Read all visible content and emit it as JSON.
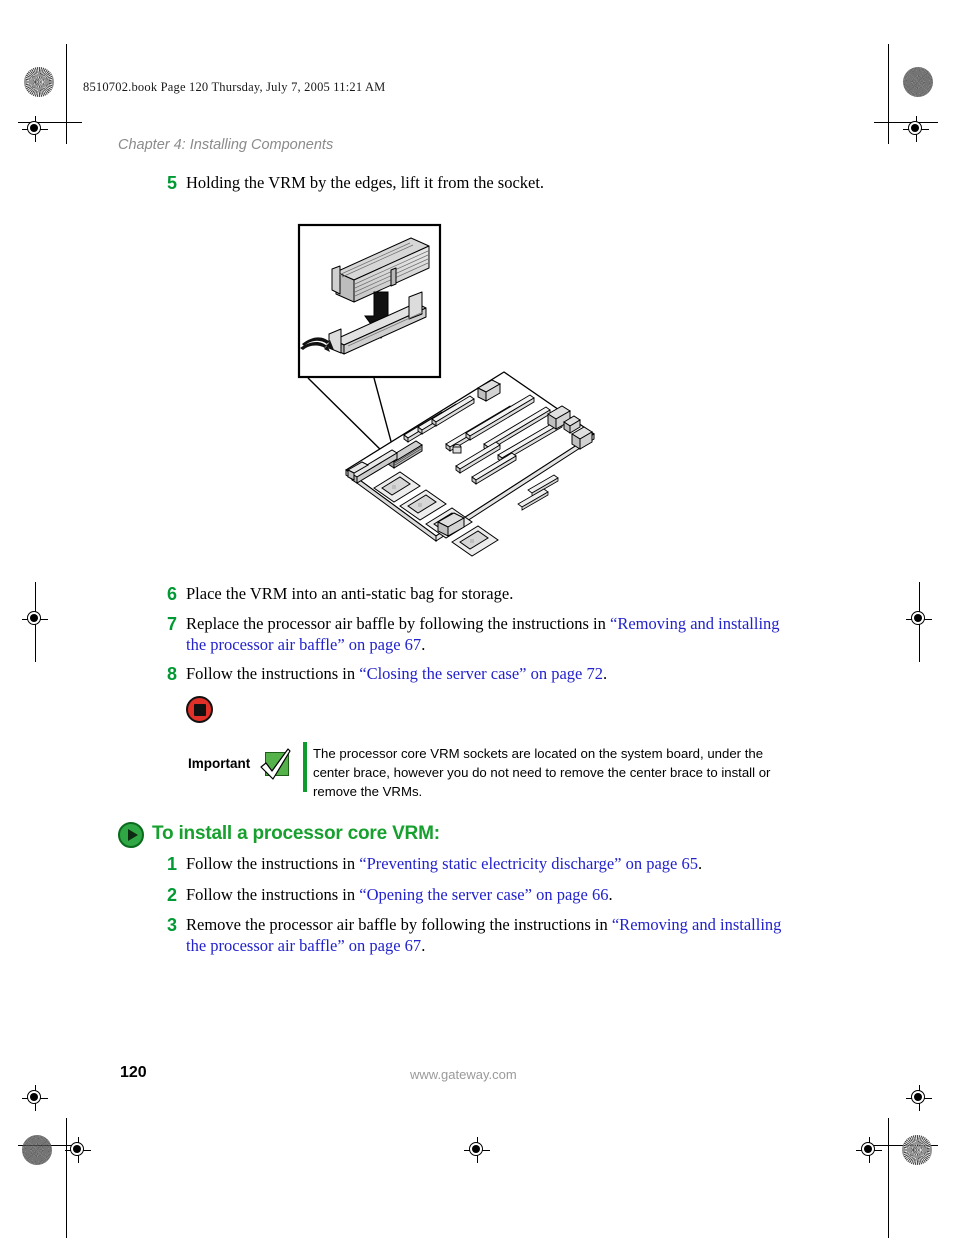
{
  "header": {
    "book_line": "8510702.book  Page 120  Thursday, July 7, 2005  11:21 AM",
    "chapter": "Chapter 4: Installing Components"
  },
  "steps_top": [
    {
      "num": "5",
      "text": "Holding the VRM by the edges, lift it from the socket."
    },
    {
      "num": "6",
      "text": "Place the VRM into an anti-static bag for storage."
    }
  ],
  "step7": {
    "num": "7",
    "pre": "Replace the processor air baffle by following the instructions in ",
    "link": "“Removing and installing the processor air baffle” on page 67",
    "post": "."
  },
  "step8": {
    "num": "8",
    "pre": "Follow the instructions in ",
    "link": "“Closing the server case” on page 72",
    "post": "."
  },
  "important": {
    "label": "Important",
    "text": "The processor core VRM sockets are located on the system board, under the center brace, however you do not need to remove the center brace to install or remove the VRMs.",
    "icon_red": "stop-circle-icon",
    "icon_check": "green-checkmark-icon"
  },
  "section_heading": {
    "icon": "play-circle-icon",
    "text": "To install a processor core VRM:"
  },
  "steps_bottom": [
    {
      "num": "1",
      "pre": "Follow the instructions in ",
      "link": "“Preventing static electricity discharge” on page 65",
      "post": "."
    },
    {
      "num": "2",
      "pre": "Follow the instructions in ",
      "link": "“Opening the server case” on page 66",
      "post": "."
    },
    {
      "num": "3",
      "pre": "Remove the processor air baffle by following the instructions in ",
      "link": "“Removing and installing the processor air baffle” on page 67",
      "post": "."
    }
  ],
  "footer": {
    "page_number": "120",
    "website": "www.gateway.com"
  },
  "colors": {
    "green": "#009933",
    "heading_green": "#17a02e",
    "link_blue": "#2222cc",
    "gray_text": "#8b8b8b",
    "red_icon": "#e03028"
  },
  "figure": {
    "name": "vrm-removal-illustration",
    "callout": "VRM module lifting out of its socket",
    "board": "server system board line drawing"
  }
}
